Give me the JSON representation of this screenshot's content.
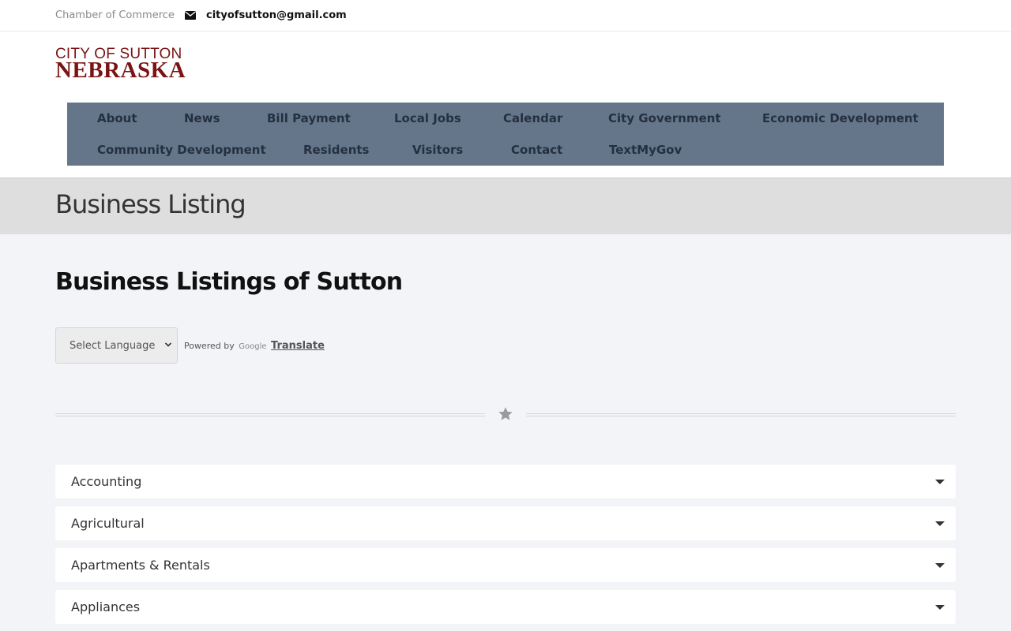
{
  "topbar": {
    "chamber_link": "Chamber of Commerce",
    "email": "cityofsutton@gmail.com",
    "email_icon": "envelope-icon"
  },
  "logo": {
    "line1": "CITY OF SUTTON",
    "line2": "NEBRASKA"
  },
  "nav": {
    "items": [
      "About",
      "News",
      "Bill Payment",
      "Local Jobs",
      "Calendar",
      "City Government",
      "Economic Development",
      "Community Development",
      "Residents",
      "Visitors",
      "Contact",
      "TextMyGov"
    ]
  },
  "page_title": "Business Listing",
  "main": {
    "heading": "Business Listings of Sutton",
    "language_select": "Select Language",
    "powered_by": "Powered by",
    "google": "Google",
    "translate": "Translate",
    "divider_icon": "star-icon"
  },
  "categories": [
    "Accounting",
    "Agricultural",
    "Apartments & Rentals",
    "Appliances"
  ],
  "colors": {
    "brand": "#7a1414",
    "nav_bg": "#66768a",
    "page_bg": "#f2f4f7"
  }
}
